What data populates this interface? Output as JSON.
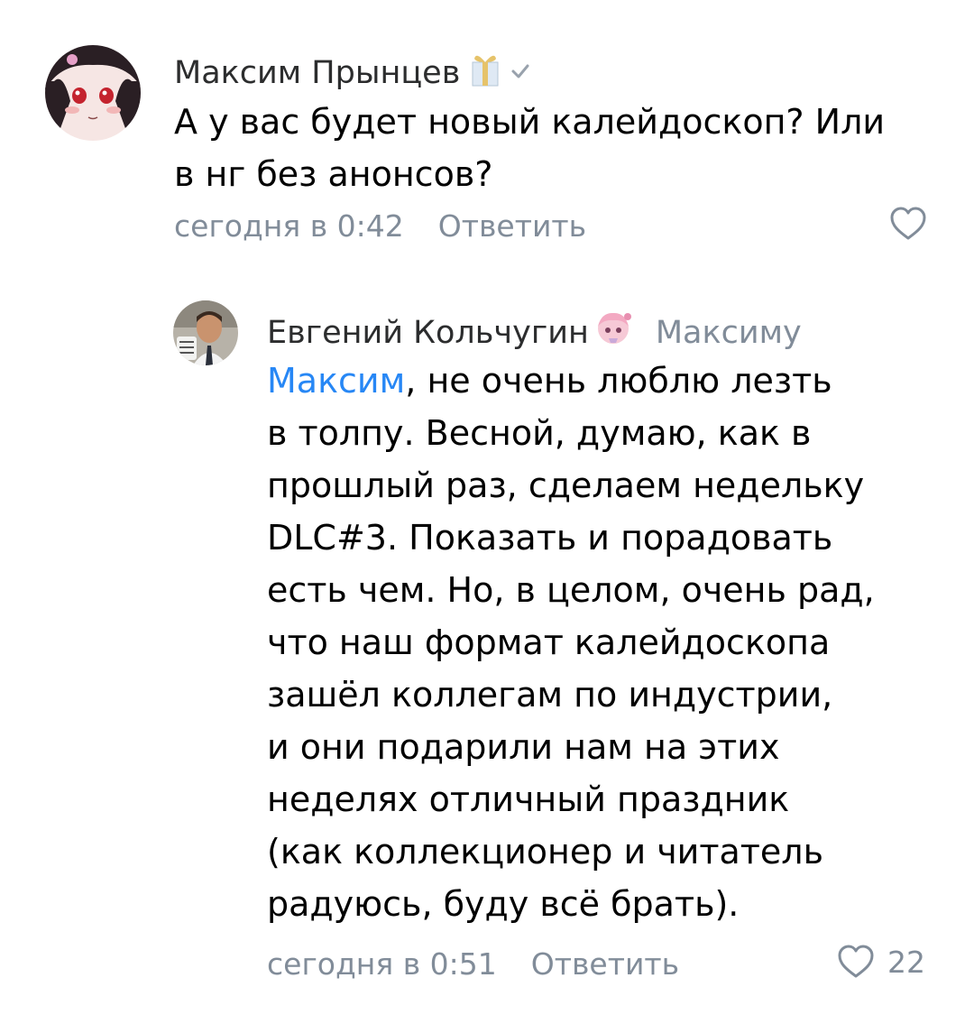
{
  "comments": [
    {
      "author": "Максим Прынцев",
      "badges": [
        "gift-icon",
        "verified-check-icon"
      ],
      "text_lines": [
        "А у вас будет новый калейдоскоп? Или",
        "в нг без анонсов?"
      ],
      "time": "сегодня в 0:42",
      "reply_label": "Ответить",
      "likes": ""
    },
    {
      "author": "Евгений Кольчугин",
      "badges": [
        "anime-sticker-icon"
      ],
      "reply_to": "Максиму",
      "mention": "Максим",
      "text_first_rest": ", не очень люблю лезть",
      "text_lines": [
        "в толпу. Весной, думаю, как в",
        "прошлый раз, сделаем недельку",
        "DLC#3. Показать и порадовать",
        "есть чем. Но, в целом, очень рад,",
        "что наш формат калейдоскопа",
        "зашёл коллегам по индустрии,",
        "и они подарили нам на этих",
        "неделях отличный праздник",
        "(как коллекционер и читатель",
        "радуюсь, буду всё брать)."
      ],
      "time": "сегодня в 0:51",
      "reply_label": "Ответить",
      "likes": "22"
    }
  ],
  "colors": {
    "mention": "#2787f5",
    "meta": "#818c99",
    "name": "#2c2d2e"
  }
}
